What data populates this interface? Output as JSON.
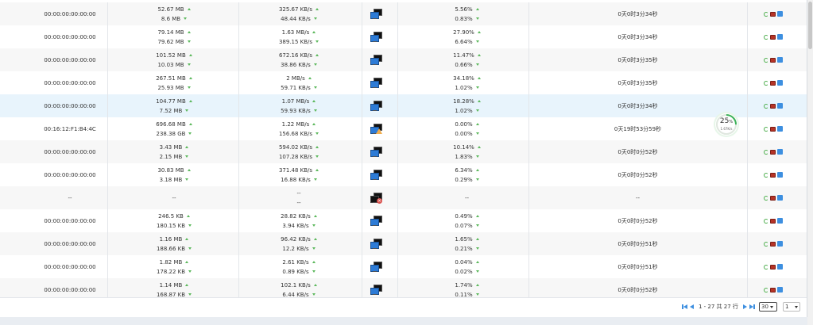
{
  "rows": [
    {
      "mac": "00:00:00:00:00:00",
      "traffic": [
        "52.67 MB",
        "8.6 MB"
      ],
      "speed": [
        "325.67 KB/s",
        "48.44 KB/s"
      ],
      "status": "online",
      "ratio": [
        "5.56%",
        "0.83%"
      ],
      "uptime": "0天0时3分34秒"
    },
    {
      "mac": "00:00:00:00:00:00",
      "traffic": [
        "79.14 MB",
        "79.62 MB"
      ],
      "speed": [
        "1.63 MB/s",
        "389.15 KB/s"
      ],
      "status": "online",
      "ratio": [
        "27.90%",
        "6.64%"
      ],
      "uptime": "0天0时3分34秒"
    },
    {
      "mac": "00:00:00:00:00:00",
      "traffic": [
        "101.52 MB",
        "10.03 MB"
      ],
      "speed": [
        "672.16 KB/s",
        "38.86 KB/s"
      ],
      "status": "online",
      "ratio": [
        "11.47%",
        "0.66%"
      ],
      "uptime": "0天0时3分35秒"
    },
    {
      "mac": "00:00:00:00:00:00",
      "traffic": [
        "267.51 MB",
        "25.93 MB"
      ],
      "speed": [
        "2 MB/s",
        "59.71 KB/s"
      ],
      "status": "online",
      "ratio": [
        "34.18%",
        "1.02%"
      ],
      "uptime": "0天0时3分35秒"
    },
    {
      "mac": "00:00:00:00:00:00",
      "traffic": [
        "104.77 MB",
        "7.52 MB"
      ],
      "speed": [
        "1.07 MB/s",
        "59.93 KB/s"
      ],
      "status": "online",
      "ratio": [
        "18.28%",
        "1.02%"
      ],
      "uptime": "0天0时3分34秒"
    },
    {
      "mac": "00:16:12:F1:B4:4C",
      "traffic": [
        "696.68 MB",
        "238.38 GB"
      ],
      "speed": [
        "1.22 MB/s",
        "156.68 KB/s"
      ],
      "status": "warning",
      "ratio": [
        "0.00%",
        "0.00%"
      ],
      "uptime": "0天19时53分59秒"
    },
    {
      "mac": "00:00:00:00:00:00",
      "traffic": [
        "3.43 MB",
        "2.15 MB"
      ],
      "speed": [
        "594.02 KB/s",
        "107.28 KB/s"
      ],
      "status": "online",
      "ratio": [
        "10.14%",
        "1.83%"
      ],
      "uptime": "0天0时0分52秒"
    },
    {
      "mac": "00:00:00:00:00:00",
      "traffic": [
        "30.83 MB",
        "3.18 MB"
      ],
      "speed": [
        "371.48 KB/s",
        "16.88 KB/s"
      ],
      "status": "online",
      "ratio": [
        "6.34%",
        "0.29%"
      ],
      "uptime": "0天0时0分52秒"
    },
    {
      "mac": "--",
      "traffic": [
        "--"
      ],
      "speed": [
        "--",
        "--"
      ],
      "status": "offline",
      "ratio": [
        "--"
      ],
      "uptime": "--"
    },
    {
      "mac": "00:00:00:00:00:00",
      "traffic": [
        "246.5 KB",
        "180.15 KB"
      ],
      "speed": [
        "28.82 KB/s",
        "3.94 KB/s"
      ],
      "status": "online",
      "ratio": [
        "0.49%",
        "0.07%"
      ],
      "uptime": "0天0时0分52秒"
    },
    {
      "mac": "00:00:00:00:00:00",
      "traffic": [
        "1.16 MB",
        "188.66 KB"
      ],
      "speed": [
        "96.42 KB/s",
        "12.2 KB/s"
      ],
      "status": "online",
      "ratio": [
        "1.65%",
        "0.21%"
      ],
      "uptime": "0天0时0分51秒"
    },
    {
      "mac": "00:00:00:00:00:00",
      "traffic": [
        "1.82 MB",
        "178.22 KB"
      ],
      "speed": [
        "2.61 KB/s",
        "0.89 KB/s"
      ],
      "status": "online",
      "ratio": [
        "0.04%",
        "0.02%"
      ],
      "uptime": "0天0时0分51秒"
    },
    {
      "mac": "00:00:00:00:00:00",
      "traffic": [
        "1.14 MB",
        "168.87 KB"
      ],
      "speed": [
        "102.1 KB/s",
        "6.44 KB/s"
      ],
      "status": "online",
      "ratio": [
        "1.74%",
        "0.11%"
      ],
      "uptime": "0天0时0分52秒"
    }
  ],
  "highlight_row": 4,
  "gauge": {
    "percent": "25",
    "unit": "%",
    "speed": "1.67K/s",
    "fraction": 0.25,
    "color": "#3cb35a"
  },
  "icons": {
    "refresh": "refresh-icon",
    "screen": "remote-screen-icon",
    "edit": "edit-icon"
  },
  "pagination": {
    "summary": "1 - 27 共 27 行",
    "page_size": "30",
    "page": "1"
  },
  "colors": {
    "accent": "#3d8fe0",
    "arrow": "#5cb85c",
    "highlight": "#e8f4fc"
  }
}
